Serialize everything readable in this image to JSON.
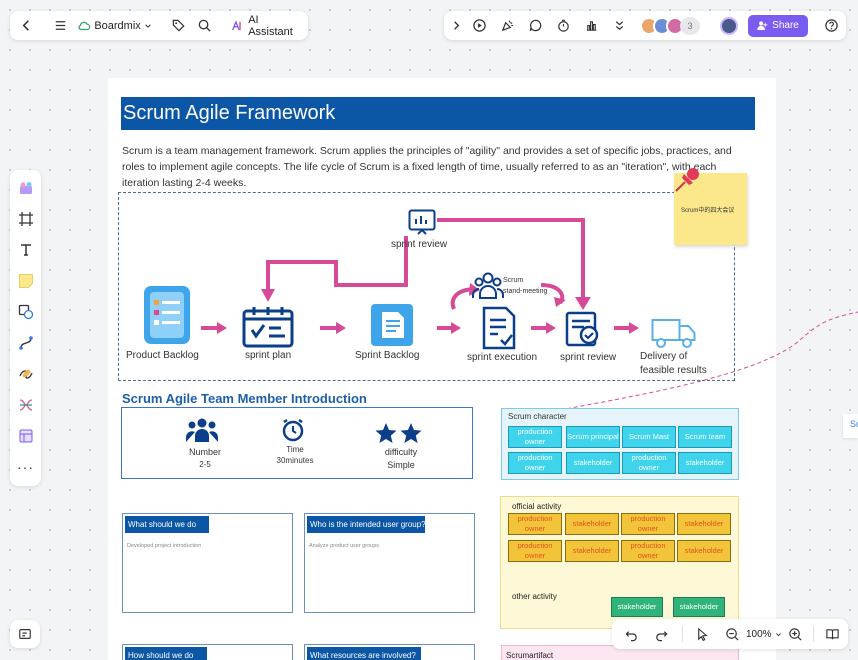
{
  "toolbar": {
    "board_name": "Boardmix",
    "ai_label": "AI Assistant",
    "collab_count": "3",
    "share_label": "Share"
  },
  "doc": {
    "title": "Scrum Agile Framework",
    "intro": "Scrum is a team management framework. Scrum applies the principles of \"agility\" and provides a set of specific jobs, practices, and roles to implement agile concepts. The life cycle of Scrum is a fixed length of time, usually referred to as an \"iteration\", with each iteration lasting 2-4 weeks.",
    "sticky_note": "Scrum中的四大会议",
    "flow": {
      "product_backlog": "Product Backlog",
      "sprint_plan": "sprint plan",
      "sprint_backlog": "Sprint Backlog",
      "sprint_execution": "sprint execution",
      "sprint_review_top": "sprint review",
      "sprint_review": "sprint review",
      "scrum_standup": "Scrum\nstand-meeting",
      "delivery": "Delivery of\nfeasible results"
    },
    "team_section_title": "Scrum Agile Team Member Introduction",
    "team_info": [
      {
        "label": "Number",
        "value": "2-5"
      },
      {
        "label": "Time",
        "value": "30minutes"
      },
      {
        "label": "difficulty",
        "value": "Simple"
      }
    ],
    "questions": [
      {
        "title": "What should we do",
        "sub": "Developed project introduction"
      },
      {
        "title": "Who is the intended user group?",
        "sub": "Analyze product user groups"
      },
      {
        "title": "How should we do",
        "sub": ""
      },
      {
        "title": "What resources are involved?",
        "sub": ""
      }
    ],
    "scrum_character": {
      "title": "Scrum character",
      "chips": [
        "production owner",
        "Scrum principal",
        "Scrum Mast",
        "Scrum team",
        "production owner",
        "stakeholder",
        "production owner",
        "stakeholder"
      ]
    },
    "official_activity": {
      "title": "official activity",
      "chips": [
        "production owner",
        "stakeholder",
        "production owner",
        "stakeholder",
        "production owner",
        "stakeholder",
        "production owner",
        "stakeholder"
      ]
    },
    "other_activity": {
      "title": "other activity",
      "chips": [
        "stakeholder",
        "stakeholder"
      ]
    },
    "scrum_artifact": {
      "title": "Scrumartifact"
    }
  },
  "right_edge_text": "Sc",
  "zoom": {
    "level": "100%"
  },
  "colors": {
    "accent": "#7b5cf0",
    "title_blue": "#0b57a5",
    "flow_pink": "#d64a98",
    "cyan": "#3fd3ec",
    "orange": "#f2c43a",
    "green": "#2fb37a"
  }
}
